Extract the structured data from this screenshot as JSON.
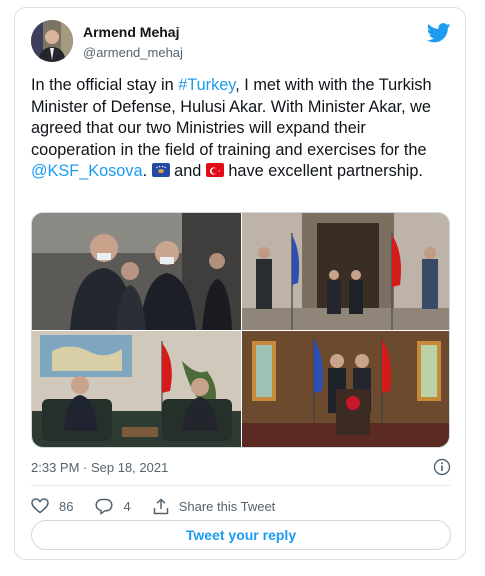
{
  "author": {
    "display_name": "Armend Mehaj",
    "handle": "@armend_mehaj"
  },
  "tweet": {
    "text_part1": "In the official stay in ",
    "hashtag": "#Turkey",
    "text_part2": ", I met with with the Turkish Minister of Defense, Hulusi Akar. With Minister Akar, we agreed that our two Ministries will expand their cooperation in the field of training and exercises for the ",
    "mention": "@KSF_Kosova",
    "text_part3": ". ",
    "text_part4": " and ",
    "text_part5": " have excellent partnership.",
    "flag_emoji_1": "kosovo-flag",
    "flag_emoji_2": "turkey-flag",
    "timestamp": "2:33 PM · Sep 18, 2021"
  },
  "media": {
    "photos": [
      "meeting-handshake-photo",
      "honor-guard-flags-photo",
      "office-meeting-photo",
      "press-podium-photo"
    ]
  },
  "stats": {
    "likes": "86",
    "replies": "4",
    "share_label": "Share this Tweet"
  },
  "reply_button": "Tweet your reply",
  "colors": {
    "accent": "#1d9bf0",
    "text": "#0f1419",
    "muted": "#536471",
    "border": "#cfd9de"
  }
}
